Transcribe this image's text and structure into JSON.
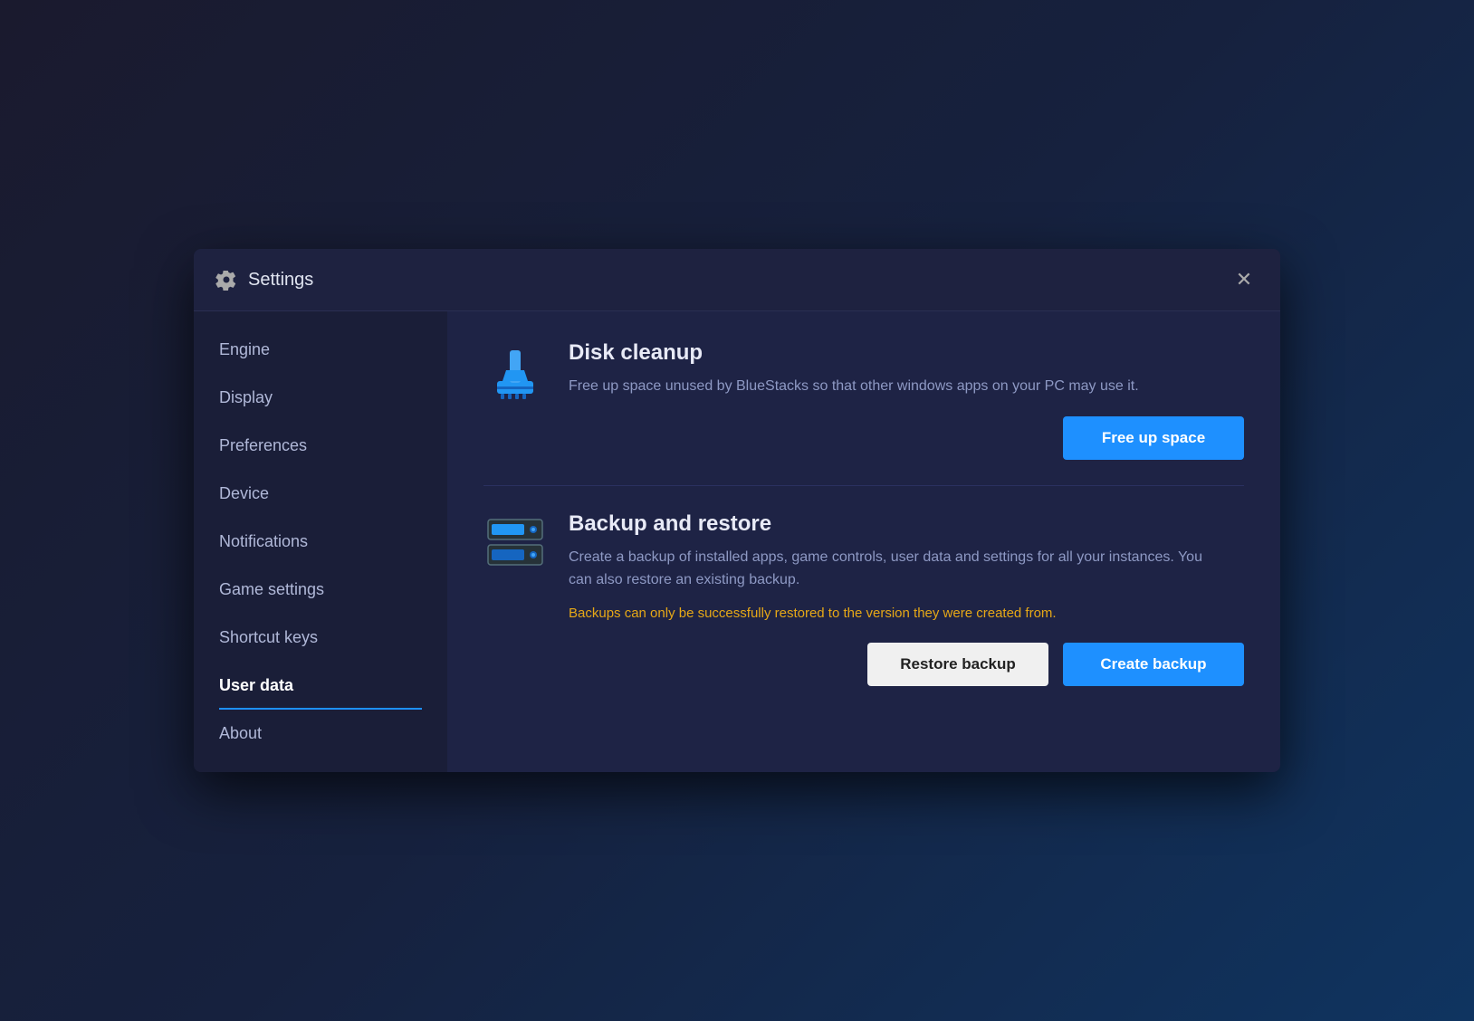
{
  "titleBar": {
    "title": "Settings",
    "closeLabel": "✕",
    "gearIcon": "⚙"
  },
  "sidebar": {
    "items": [
      {
        "id": "engine",
        "label": "Engine",
        "active": false
      },
      {
        "id": "display",
        "label": "Display",
        "active": false
      },
      {
        "id": "preferences",
        "label": "Preferences",
        "active": false
      },
      {
        "id": "device",
        "label": "Device",
        "active": false
      },
      {
        "id": "notifications",
        "label": "Notifications",
        "active": false
      },
      {
        "id": "game-settings",
        "label": "Game settings",
        "active": false
      },
      {
        "id": "shortcut-keys",
        "label": "Shortcut keys",
        "active": false
      },
      {
        "id": "user-data",
        "label": "User data",
        "active": true
      },
      {
        "id": "about",
        "label": "About",
        "active": false
      }
    ]
  },
  "content": {
    "diskCleanup": {
      "title": "Disk cleanup",
      "description": "Free up space unused by BlueStacks so that other windows apps on your PC may use it.",
      "buttonLabel": "Free up space"
    },
    "backupRestore": {
      "title": "Backup and restore",
      "description": "Create a backup of installed apps, game controls, user data and settings for all your instances. You can also restore an existing backup.",
      "warningText": "Backups can only be successfully restored to the version they were created from.",
      "restoreLabel": "Restore backup",
      "createLabel": "Create backup"
    }
  },
  "colors": {
    "accent": "#1e90ff",
    "warning": "#e6a817",
    "primaryBg": "#1e2240",
    "sidebarBg": "#1a1e38",
    "contentBg": "#1e2345"
  }
}
